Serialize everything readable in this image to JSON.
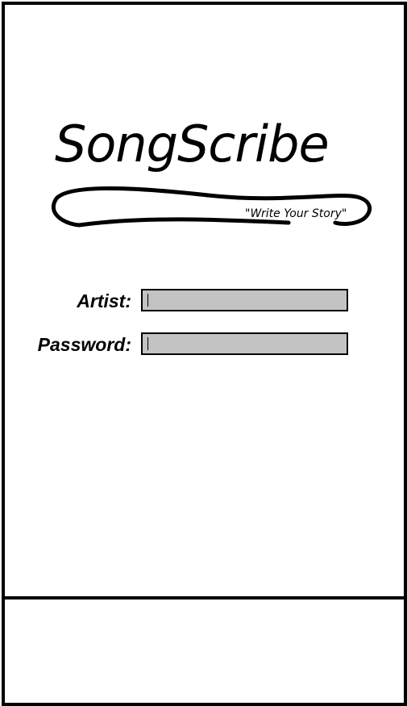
{
  "app": {
    "title": "SongScribe",
    "tagline": "\"Write Your Story\""
  },
  "login": {
    "artist_label": "Artist:",
    "artist_value": "",
    "artist_placeholder": "",
    "password_label": "Password:",
    "password_value": "",
    "password_placeholder": ""
  },
  "colors": {
    "frame": "#000000",
    "background": "#ffffff",
    "input_fill": "#c3c3c3"
  }
}
